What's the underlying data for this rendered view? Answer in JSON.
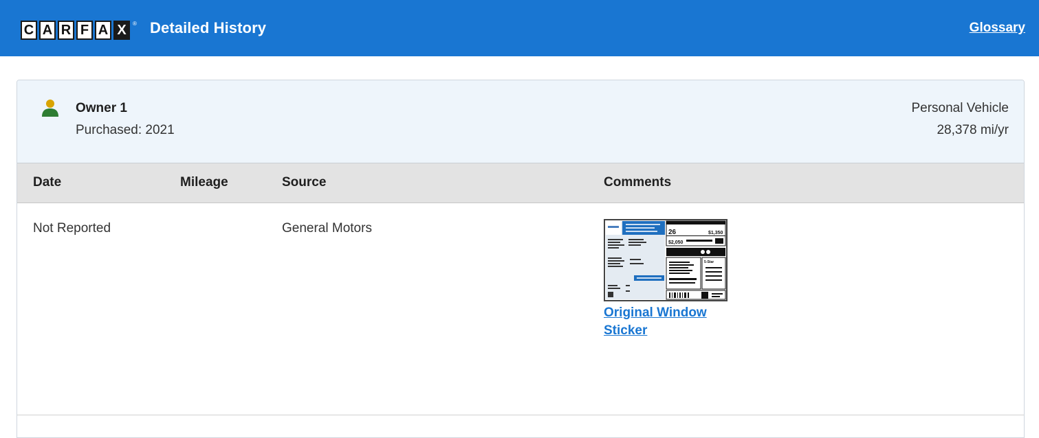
{
  "header": {
    "logo_letters": [
      "C",
      "A",
      "R",
      "F",
      "A",
      "X"
    ],
    "title": "Detailed History",
    "glossary_label": "Glossary",
    "bar_color": "#1976d2"
  },
  "owner": {
    "icon": "person-icon",
    "name": "Owner 1",
    "purchased": "Purchased: 2021",
    "vehicle_type": "Personal Vehicle",
    "miles_per_year": "28,378 mi/yr"
  },
  "table": {
    "columns": [
      "Date",
      "Mileage",
      "Source",
      "Comments"
    ],
    "rows": [
      {
        "date": "Not Reported",
        "mileage": "",
        "source": "General Motors",
        "comment_link": "Original Window Sticker",
        "comment_thumbnail": "window-sticker-thumbnail"
      }
    ]
  }
}
